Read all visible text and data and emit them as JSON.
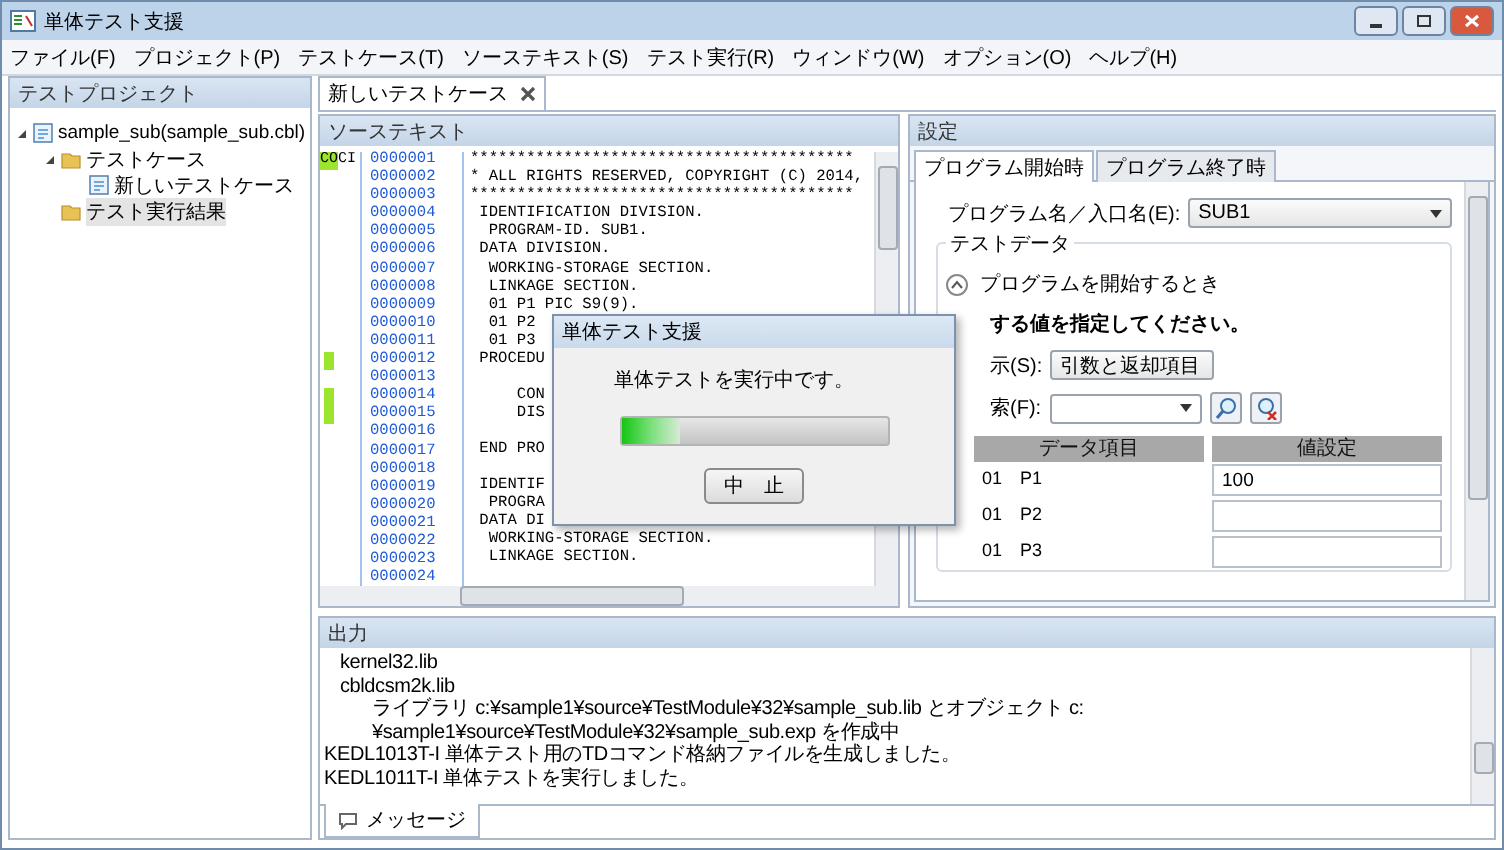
{
  "window": {
    "title": "単体テスト支援"
  },
  "menu": [
    "ファイル(F)",
    "プロジェクト(P)",
    "テストケース(T)",
    "ソーステキスト(S)",
    "テスト実行(R)",
    "ウィンドウ(W)",
    "オプション(O)",
    "ヘルプ(H)"
  ],
  "project_panel": {
    "title": "テストプロジェクト",
    "tree": [
      {
        "label": "sample_sub(sample_sub.cbl)",
        "kind": "project",
        "expanded": true,
        "selected": false,
        "children": [
          {
            "label": "テストケース",
            "kind": "folder",
            "expanded": true,
            "selected": false,
            "children": [
              {
                "label": "新しいテストケース",
                "kind": "case",
                "selected": false
              }
            ]
          },
          {
            "label": "テスト実行結果",
            "kind": "folder",
            "selected": true
          }
        ]
      }
    ]
  },
  "editor_tabs": [
    {
      "label": "新しいテストケース",
      "selected": true
    }
  ],
  "source": {
    "title": "ソーステキスト",
    "lines": [
      {
        "no": "0000001",
        "code": "*****************************************",
        "tags": [
          "CO",
          "CI"
        ]
      },
      {
        "no": "0000002",
        "code": "* ALL RIGHTS RESERVED, COPYRIGHT (C) 2014,",
        "mark": false
      },
      {
        "no": "0000003",
        "code": "*****************************************",
        "mark": false
      },
      {
        "no": "0000004",
        "code": " IDENTIFICATION DIVISION.",
        "mark": false
      },
      {
        "no": "0000005",
        "code": "  PROGRAM-ID. SUB1.",
        "mark": false
      },
      {
        "no": "0000006",
        "code": " DATA DIVISION.",
        "mark": false
      },
      {
        "no": "0000007",
        "code": "  WORKING-STORAGE SECTION.",
        "mark": false
      },
      {
        "no": "0000008",
        "code": "  LINKAGE SECTION.",
        "mark": false
      },
      {
        "no": "0000009",
        "code": "  01 P1 PIC S9(9).",
        "mark": false
      },
      {
        "no": "0000010",
        "code": "  01 P2",
        "mark": false
      },
      {
        "no": "0000011",
        "code": "  01 P3",
        "mark": false
      },
      {
        "no": "0000012",
        "code": " PROCEDU",
        "mark": true
      },
      {
        "no": "0000013",
        "mark": false
      },
      {
        "no": "0000014",
        "code": "     CON",
        "mark": true
      },
      {
        "no": "0000015",
        "code": "     DIS",
        "mark": true
      },
      {
        "no": "0000016",
        "mark": false
      },
      {
        "no": "0000017",
        "code": " END PRO",
        "mark": false
      },
      {
        "no": "0000018",
        "mark": false
      },
      {
        "no": "0000019",
        "code": " IDENTIF",
        "mark": false
      },
      {
        "no": "0000020",
        "code": "  PROGRA",
        "mark": false
      },
      {
        "no": "0000021",
        "code": " DATA DI",
        "mark": false
      },
      {
        "no": "0000022",
        "code": "  WORKING-STORAGE SECTION.",
        "mark": false
      },
      {
        "no": "0000023",
        "code": "  LINKAGE SECTION.",
        "mark": false
      },
      {
        "no": "0000024",
        "mark": false
      }
    ]
  },
  "settings": {
    "title": "設定",
    "tabs": [
      {
        "label": "プログラム開始時",
        "selected": true
      },
      {
        "label": "プログラム終了時",
        "selected": false
      }
    ],
    "program_label": "プログラム名／入口名(E):",
    "program_value": "SUB1",
    "group_title": "テストデータ",
    "section_title": "プログラムを開始するとき",
    "instruction": "する値を指定してください。",
    "display_label": "示(S):",
    "display_value": "引数と返却項目",
    "search_label": "索(F):",
    "columns": [
      "データ項目",
      "値設定"
    ],
    "rows": [
      {
        "item": "01　P1",
        "value": "100"
      },
      {
        "item": "01　P2"
      },
      {
        "item": "01　P3"
      }
    ]
  },
  "dialog": {
    "title": "単体テスト支援",
    "message": "単体テストを実行中です。",
    "level": 0.22,
    "button": "中　止"
  },
  "output": {
    "title": "出力",
    "lines": [
      {
        "text": "kernel32.lib",
        "kind": "file"
      },
      {
        "text": "cbldcsm2k.lib",
        "kind": "file"
      },
      {
        "text": "ライブラリ c:¥sample1¥source¥TestModule¥32¥sample_sub.lib とオブジェクト c:¥sample1¥source¥TestModule¥32¥sample_sub.exp を作成中",
        "kind": "detail"
      },
      {
        "text": "KEDL1013T-I 単体テスト用のTDコマンド格納ファイルを生成しました。",
        "kind": "message"
      },
      {
        "text": "KEDL1011T-I 単体テストを実行しました。",
        "kind": "message"
      }
    ],
    "tabs": [
      {
        "label": "メッセージ",
        "selected": true
      }
    ]
  }
}
